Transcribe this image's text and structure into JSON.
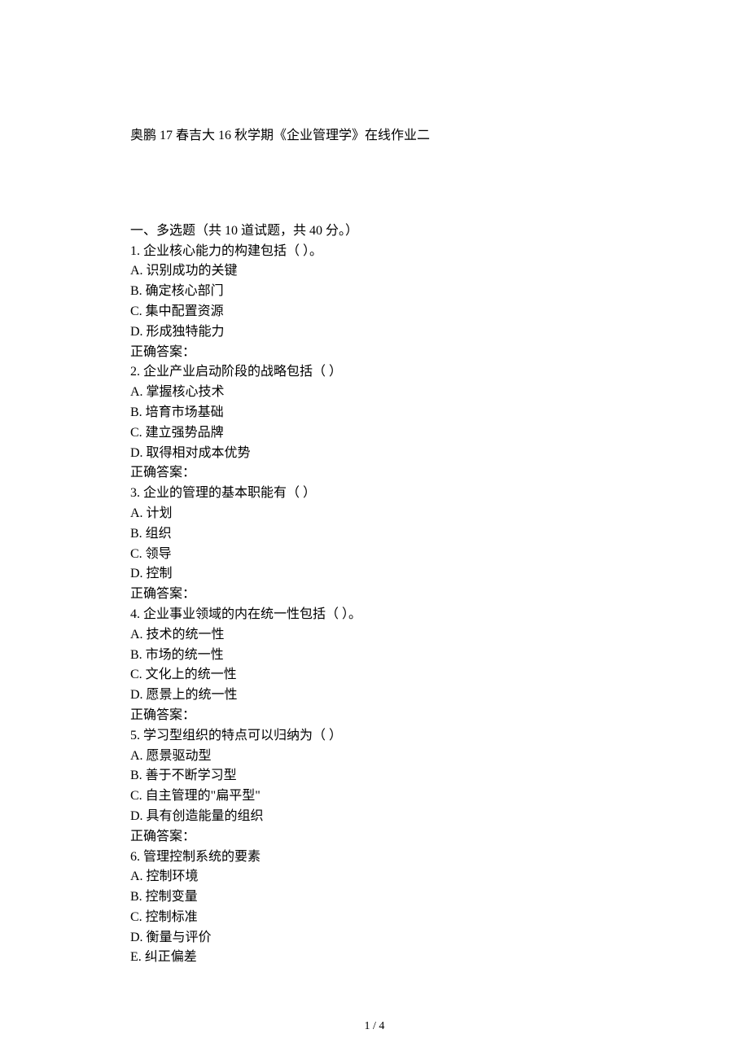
{
  "doc_title": "奥鹏 17 春吉大 16 秋学期《企业管理学》在线作业二",
  "section_header": "一、多选题（共 10 道试题，共 40 分。）",
  "questions": [
    {
      "num": "1.",
      "stem": "企业核心能力的构建包括（  ）。",
      "options": [
        "A.  识别成功的关键",
        "B.  确定核心部门",
        "C.  集中配置资源",
        "D.  形成独特能力"
      ],
      "answer_label": "正确答案："
    },
    {
      "num": "2.",
      "stem": "企业产业启动阶段的战略包括（  ）",
      "options": [
        "A.  掌握核心技术",
        "B.  培育市场基础",
        "C.  建立强势品牌",
        "D.  取得相对成本优势"
      ],
      "answer_label": "正确答案："
    },
    {
      "num": "3.",
      "stem": "企业的管理的基本职能有（  ）",
      "options": [
        "A.  计划",
        "B.  组织",
        "C.  领导",
        "D.  控制"
      ],
      "answer_label": "正确答案："
    },
    {
      "num": "4.",
      "stem": "企业事业领域的内在统一性包括（  ）。",
      "options": [
        "A.  技术的统一性",
        "B.  市场的统一性",
        "C.  文化上的统一性",
        "D.  愿景上的统一性"
      ],
      "answer_label": "正确答案："
    },
    {
      "num": "5.",
      "stem": "学习型组织的特点可以归纳为（  ）",
      "options": [
        "A.  愿景驱动型",
        "B.  善于不断学习型",
        "C.  自主管理的\"扁平型\"",
        "D.  具有创造能量的组织"
      ],
      "answer_label": "正确答案："
    },
    {
      "num": "6.",
      "stem": "管理控制系统的要素",
      "options": [
        "A.  控制环境",
        "B.  控制变量",
        "C.  控制标准",
        "D.  衡量与评价",
        "E.  纠正偏差"
      ],
      "answer_label": ""
    }
  ],
  "footer": "1 / 4"
}
